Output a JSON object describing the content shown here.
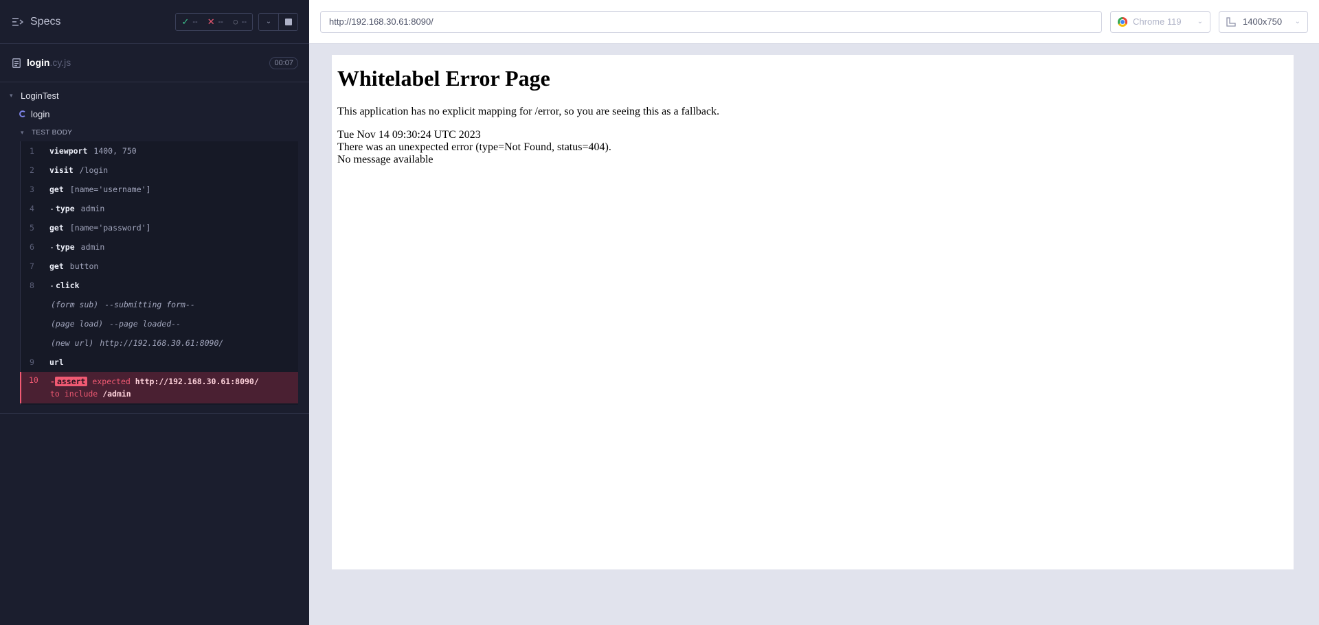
{
  "reporter": {
    "specs_label": "Specs",
    "stats": {
      "passed": "--",
      "failed": "--",
      "pending": "--"
    },
    "file": {
      "name": "login",
      "ext": ".cy.js",
      "duration": "00:07"
    },
    "suite": "LoginTest",
    "test": "login",
    "body_label": "TEST BODY",
    "commands": [
      {
        "num": "1",
        "name": "viewport",
        "msg": "1400, 750",
        "child": false
      },
      {
        "num": "2",
        "name": "visit",
        "msg": "/login",
        "child": false
      },
      {
        "num": "3",
        "name": "get",
        "msg": "[name='username']",
        "child": false
      },
      {
        "num": "4",
        "name": "type",
        "msg": "admin",
        "child": true
      },
      {
        "num": "5",
        "name": "get",
        "msg": "[name='password']",
        "child": false
      },
      {
        "num": "6",
        "name": "type",
        "msg": "admin",
        "child": true
      },
      {
        "num": "7",
        "name": "get",
        "msg": "button",
        "child": false
      },
      {
        "num": "8",
        "name": "click",
        "msg": "",
        "child": true
      }
    ],
    "events": [
      {
        "name": "(form sub)",
        "msg": "--submitting form--"
      },
      {
        "name": "(page load)",
        "msg": "--page loaded--"
      },
      {
        "name": "(new url)",
        "msg": "http://192.168.30.61:8090/"
      }
    ],
    "cmd9": {
      "num": "9",
      "name": "url"
    },
    "failed": {
      "num": "10",
      "badge": "assert",
      "expected_word": "expected",
      "actual": "http://192.168.30.61:8090/",
      "to_include": "to include",
      "value": "/admin"
    }
  },
  "aut": {
    "url": "http://192.168.30.61:8090/",
    "browser": "Chrome 119",
    "viewport": "1400x750",
    "page": {
      "title": "Whitelabel Error Page",
      "intro": "This application has no explicit mapping for /error, so you are seeing this as a fallback.",
      "timestamp": "Tue Nov 14 09:30:24 UTC 2023",
      "error": "There was an unexpected error (type=Not Found, status=404).",
      "message": "No message available"
    }
  }
}
